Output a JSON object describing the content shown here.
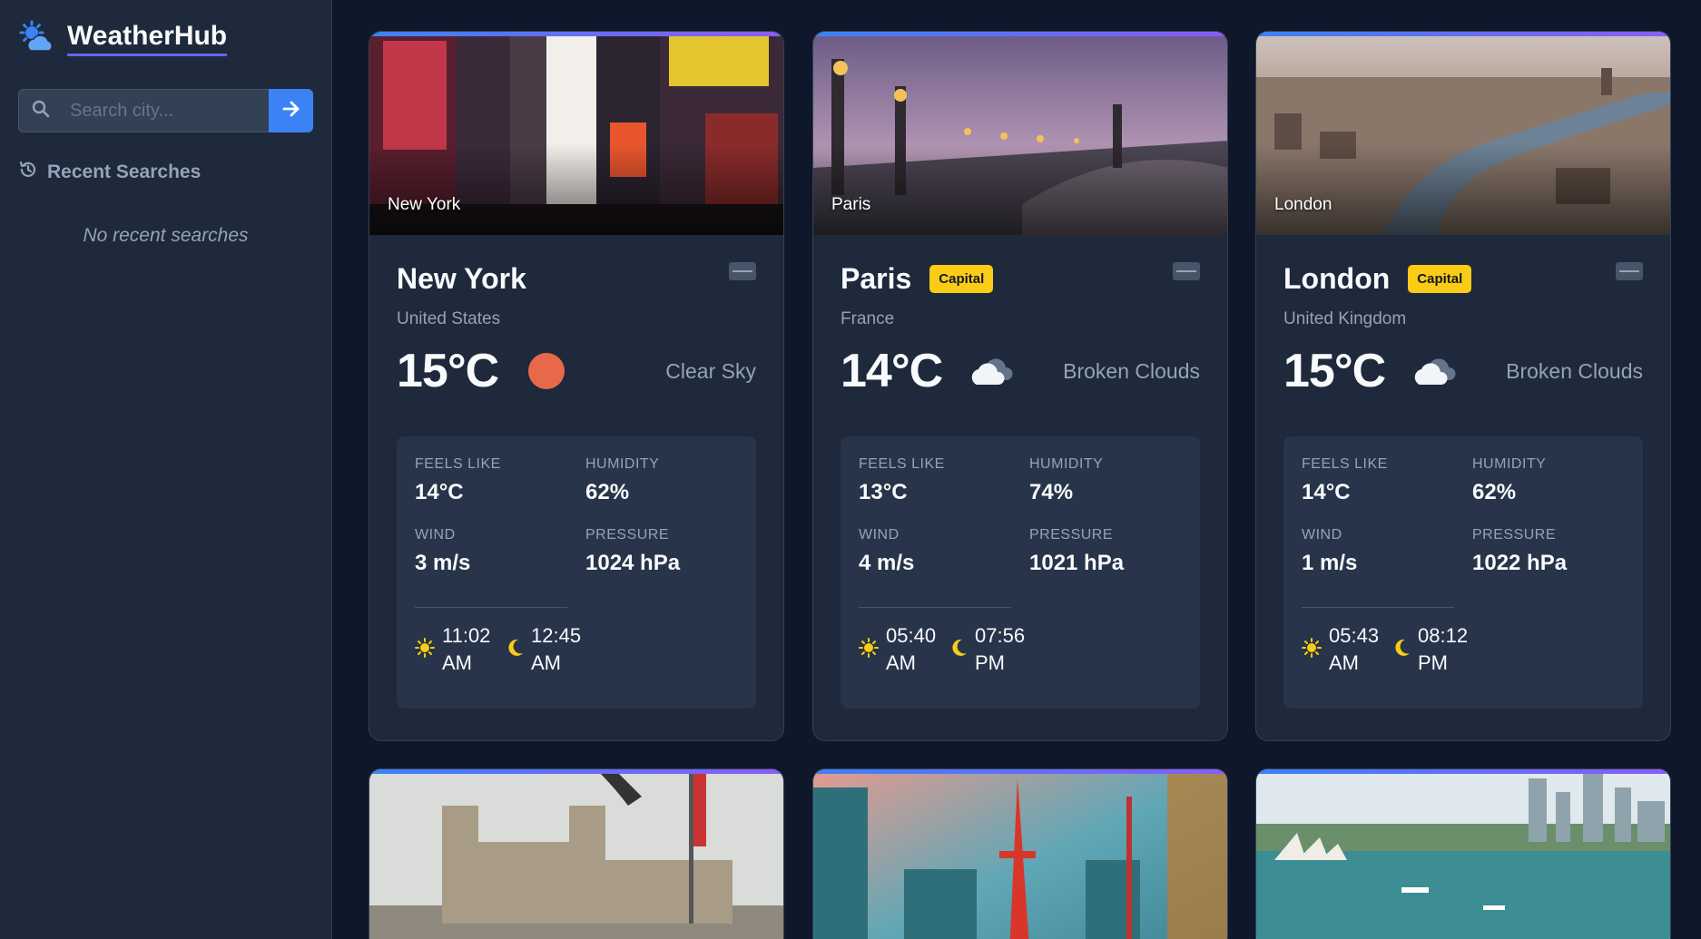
{
  "app": {
    "title": "WeatherHub"
  },
  "search": {
    "placeholder": "Search city..."
  },
  "recent": {
    "heading": "Recent Searches",
    "empty_text": "No recent searches"
  },
  "colors": {
    "accent": "#3b82f6",
    "badge": "#facc15",
    "sun": "#facc15",
    "clear_sky": "#e8694a"
  },
  "cards": [
    {
      "photo_caption": "New York",
      "city": "New York",
      "badge": "",
      "country": "United States",
      "temperature": "15°C",
      "condition": "Clear Sky",
      "icon": "clear-sky-icon",
      "feels_like_label": "FEELS LIKE",
      "feels_like": "14°C",
      "humidity_label": "HUMIDITY",
      "humidity": "62%",
      "wind_label": "WIND",
      "wind": "3 m/s",
      "pressure_label": "PRESSURE",
      "pressure": "1024 hPa",
      "sunrise": "11:02 AM",
      "sunset": "12:45 AM"
    },
    {
      "photo_caption": "Paris",
      "city": "Paris",
      "badge": "Capital",
      "country": "France",
      "temperature": "14°C",
      "condition": "Broken Clouds",
      "icon": "broken-clouds-icon",
      "feels_like_label": "FEELS LIKE",
      "feels_like": "13°C",
      "humidity_label": "HUMIDITY",
      "humidity": "74%",
      "wind_label": "WIND",
      "wind": "4 m/s",
      "pressure_label": "PRESSURE",
      "pressure": "1021 hPa",
      "sunrise": "05:40 AM",
      "sunset": "07:56 PM"
    },
    {
      "photo_caption": "London",
      "city": "London",
      "badge": "Capital",
      "country": "United Kingdom",
      "temperature": "15°C",
      "condition": "Broken Clouds",
      "icon": "broken-clouds-icon",
      "feels_like_label": "FEELS LIKE",
      "feels_like": "14°C",
      "humidity_label": "HUMIDITY",
      "humidity": "62%",
      "wind_label": "WIND",
      "wind": "1 m/s",
      "pressure_label": "PRESSURE",
      "pressure": "1022 hPa",
      "sunrise": "05:43 AM",
      "sunset": "08:12 PM"
    }
  ],
  "lower_cards": [
    {
      "photo": "cathedral-plaza-photo"
    },
    {
      "photo": "tower-city-photo"
    },
    {
      "photo": "harbour-city-photo"
    }
  ]
}
